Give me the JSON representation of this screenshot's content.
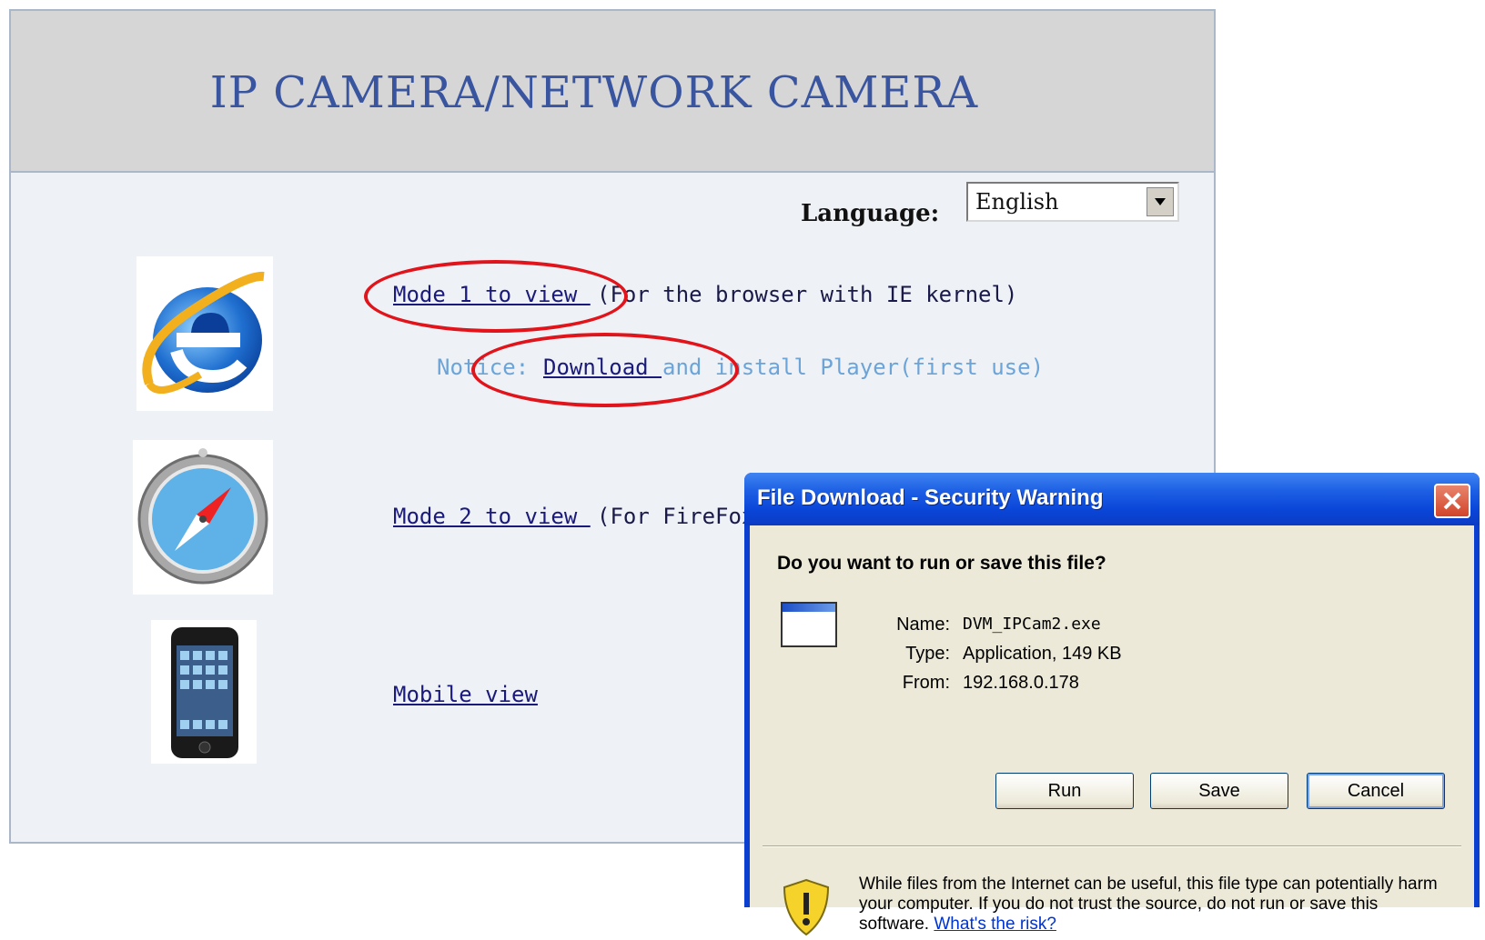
{
  "page": {
    "title": "IP CAMERA/NETWORK CAMERA",
    "language_label": "Language:",
    "language_selected": "English",
    "mode1_link": "Mode 1 to view ",
    "mode1_suffix": "(For the browser with IE kernel)",
    "notice_prefix": "Notice: ",
    "download_link": "Download ",
    "notice_suffix": "and install Player(first use)",
    "mode2_link": "Mode 2 to view ",
    "mode2_suffix": "(For FireFox",
    "mobile_link": "Mobile view",
    "icons": [
      "ie-icon",
      "safari-icon",
      "iphone-icon"
    ]
  },
  "dialog": {
    "title": "File Download - Security Warning",
    "question": "Do you want to run or save this file?",
    "name_label": "Name:",
    "name_value": "DVM_IPCam2.exe",
    "type_label": "Type:",
    "type_value": "Application, 149 KB",
    "from_label": "From:",
    "from_value": "192.168.0.178",
    "buttons": {
      "run": "Run",
      "save": "Save",
      "cancel": "Cancel"
    },
    "warning": "While files from the Internet can be useful, this file type can potentially harm your computer. If you do not trust the source, do not run or save this software. ",
    "risk_link": "What's the risk?"
  },
  "colors": {
    "title_blue": "#3a55a0",
    "link_navy": "#1a1a7a",
    "notice_blue": "#6ca4d8",
    "annotation_red": "#e0141a",
    "xp_titlebar": "#0b3fd0"
  }
}
